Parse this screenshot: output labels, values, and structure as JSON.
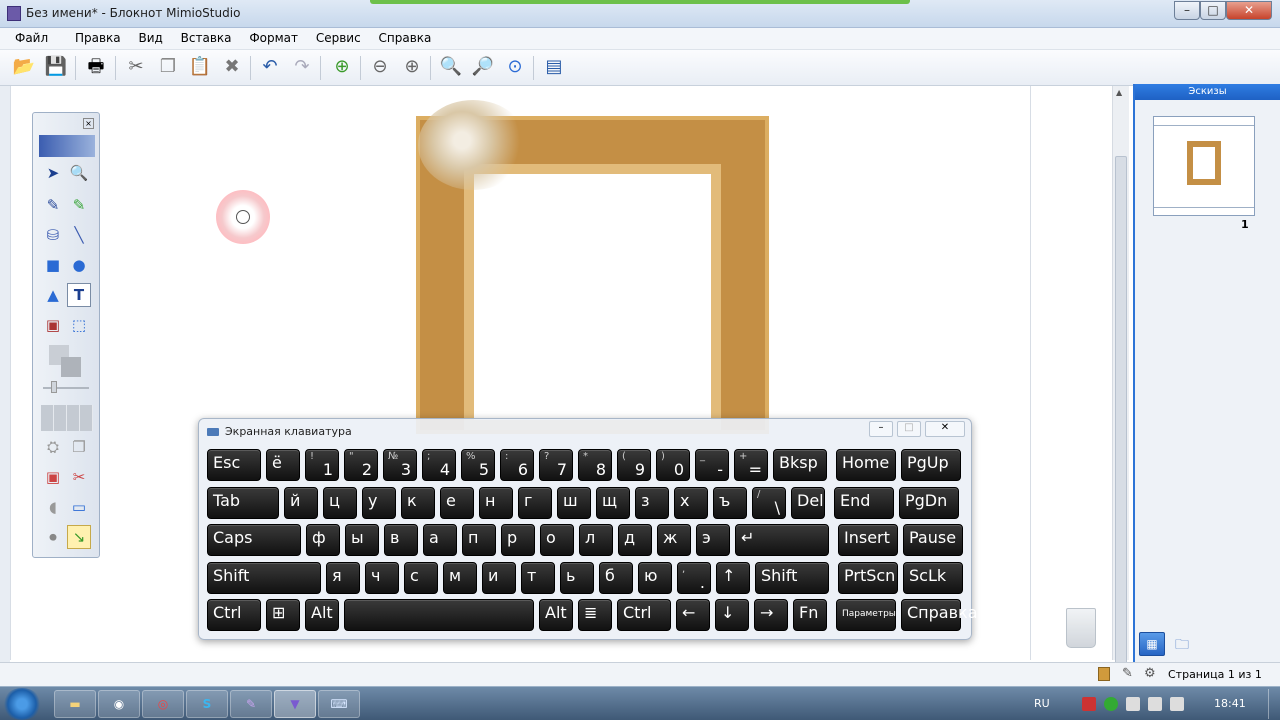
{
  "window": {
    "title": "Без имени* - Блокнот MimioStudio",
    "buttons": {
      "minimize": "–",
      "maximize": "□",
      "close": "✕"
    }
  },
  "menu": [
    "Файл",
    "Правка",
    "Вид",
    "Вставка",
    "Формат",
    "Сервис",
    "Справка"
  ],
  "toolbar_icons": [
    "open-icon",
    "save-icon",
    "print-icon",
    "cut-icon",
    "copy-icon",
    "paste-icon",
    "delete-icon",
    "undo-icon",
    "redo-icon",
    "new-page-icon",
    "back-icon",
    "forward-icon",
    "zoom-in-icon",
    "zoom-out-icon",
    "zoom-fit-icon",
    "present-icon"
  ],
  "thumbnails": {
    "header": "Эскизы",
    "page_number": "1"
  },
  "status": {
    "page": "Страница 1 из 1"
  },
  "osk": {
    "title": "Экранная клавиатура",
    "rows": [
      [
        {
          "t": "Esc"
        },
        {
          "t": "ё"
        },
        {
          "s": "!",
          "t": "1"
        },
        {
          "s": "\"",
          "t": "2"
        },
        {
          "s": "№",
          "t": "3"
        },
        {
          "s": ";",
          "t": "4"
        },
        {
          "s": "%",
          "t": "5"
        },
        {
          "s": ":",
          "t": "6"
        },
        {
          "s": "?",
          "t": "7"
        },
        {
          "s": "*",
          "t": "8"
        },
        {
          "s": "(",
          "t": "9"
        },
        {
          "s": ")",
          "t": "0"
        },
        {
          "s": "_",
          "t": "-"
        },
        {
          "s": "+",
          "t": "="
        },
        {
          "t": "Bksp"
        },
        {
          "t": "Home"
        },
        {
          "t": "PgUp"
        }
      ],
      [
        {
          "t": "Tab"
        },
        {
          "t": "й"
        },
        {
          "t": "ц"
        },
        {
          "t": "у"
        },
        {
          "t": "к"
        },
        {
          "t": "е"
        },
        {
          "t": "н"
        },
        {
          "t": "г"
        },
        {
          "t": "ш"
        },
        {
          "t": "щ"
        },
        {
          "t": "з"
        },
        {
          "t": "х"
        },
        {
          "t": "ъ"
        },
        {
          "s": "/",
          "t": "\\"
        },
        {
          "t": "Del"
        },
        {
          "t": "End"
        },
        {
          "t": "PgDn"
        }
      ],
      [
        {
          "t": "Caps"
        },
        {
          "t": "ф"
        },
        {
          "t": "ы"
        },
        {
          "t": "в"
        },
        {
          "t": "а"
        },
        {
          "t": "п"
        },
        {
          "t": "р"
        },
        {
          "t": "о"
        },
        {
          "t": "л"
        },
        {
          "t": "д"
        },
        {
          "t": "ж"
        },
        {
          "t": "э"
        },
        {
          "t": "↵"
        },
        {
          "t": "Insert"
        },
        {
          "t": "Pause"
        }
      ],
      [
        {
          "t": "Shift"
        },
        {
          "t": "я"
        },
        {
          "t": "ч"
        },
        {
          "t": "с"
        },
        {
          "t": "м"
        },
        {
          "t": "и"
        },
        {
          "t": "т"
        },
        {
          "t": "ь"
        },
        {
          "t": "б"
        },
        {
          "t": "ю"
        },
        {
          "s": ",",
          "t": "."
        },
        {
          "t": "↑"
        },
        {
          "t": "Shift"
        },
        {
          "t": "PrtScn"
        },
        {
          "t": "ScLk"
        }
      ],
      [
        {
          "t": "Ctrl"
        },
        {
          "t": "⊞"
        },
        {
          "t": "Alt"
        },
        {
          "t": ""
        },
        {
          "t": "Alt"
        },
        {
          "t": "≣"
        },
        {
          "t": "Ctrl"
        },
        {
          "t": "←"
        },
        {
          "t": "↓"
        },
        {
          "t": "→"
        },
        {
          "t": "Fn"
        },
        {
          "t": "Параметры"
        },
        {
          "t": "Справка"
        }
      ]
    ]
  },
  "taskbar": {
    "lang": "RU",
    "time": "18:41"
  }
}
